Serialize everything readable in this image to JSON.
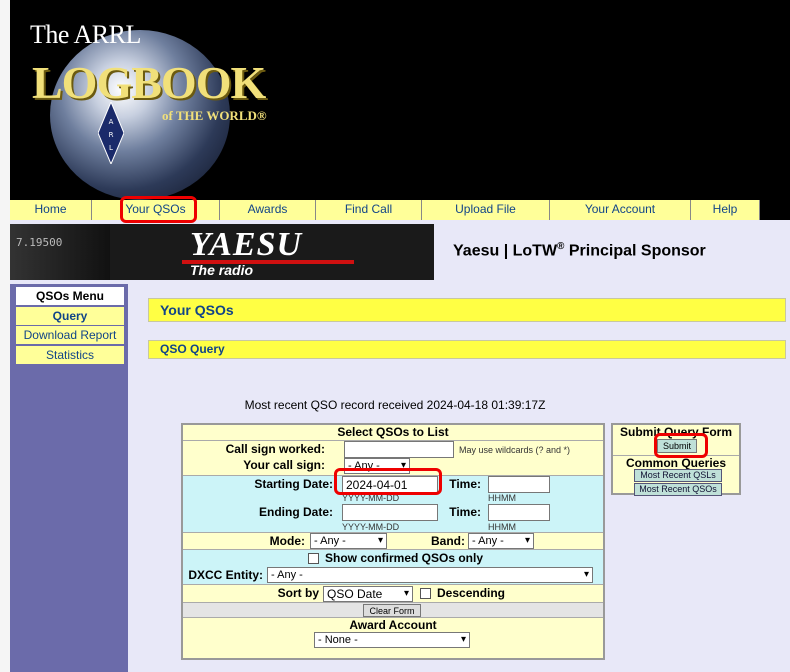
{
  "header": {
    "logo_the": "The ARRL",
    "logo_main": "LOGBOOK",
    "logo_world": "of THE WORLD®"
  },
  "nav": {
    "items": [
      "Home",
      "Your QSOs",
      "Awards",
      "Find Call",
      "Upload File",
      "Your Account",
      "Help"
    ]
  },
  "sponsor": {
    "brand": "YAESU",
    "tagline": "The radio",
    "text_prefix": "Yaesu | LoTW",
    "text_sup": "®",
    "text_suffix": " Principal Sponsor",
    "radio_display": "7.19500"
  },
  "sidebar": {
    "title": "QSOs Menu",
    "items": [
      "Query",
      "Download Report",
      "Statistics"
    ]
  },
  "page": {
    "title": "Your QSOs",
    "subtitle": "QSO Query",
    "recent": "Most recent QSO record received 2024-04-18 01:39:17Z"
  },
  "form": {
    "title": "Select QSOs to List",
    "call_worked_label": "Call sign worked:",
    "call_worked_value": "",
    "wildcard_hint": "May use wildcards (? and *)",
    "your_call_label": "Your call sign:",
    "your_call_value": "- Any -",
    "start_date_label": "Starting Date:",
    "start_date_value": "2024-04-01",
    "date_hint": "YYYY-MM-DD",
    "time_label": "Time:",
    "time_hint": "HHMM",
    "end_date_label": "Ending Date:",
    "end_date_value": "",
    "mode_label": "Mode:",
    "mode_value": "- Any -",
    "band_label": "Band:",
    "band_value": "- Any -",
    "confirmed_label": "Show confirmed QSOs only",
    "dxcc_label": "DXCC Entity:",
    "dxcc_value": "- Any -",
    "sort_label": "Sort by",
    "sort_value": "QSO Date",
    "descending_label": "Descending",
    "clear_label": "Clear Form",
    "award_title": "Award Account",
    "award_value": "- None -"
  },
  "side_form": {
    "title": "Submit Query Form",
    "submit_label": "Submit",
    "common_title": "Common Queries",
    "q1": "Most Recent QSLs",
    "q2": "Most Recent QSOs"
  },
  "colors": {
    "nav_bg": "#ffff99",
    "accent_yellow": "#ffff44",
    "highlight": "#ee0000",
    "sidebar": "#6b6baa"
  }
}
